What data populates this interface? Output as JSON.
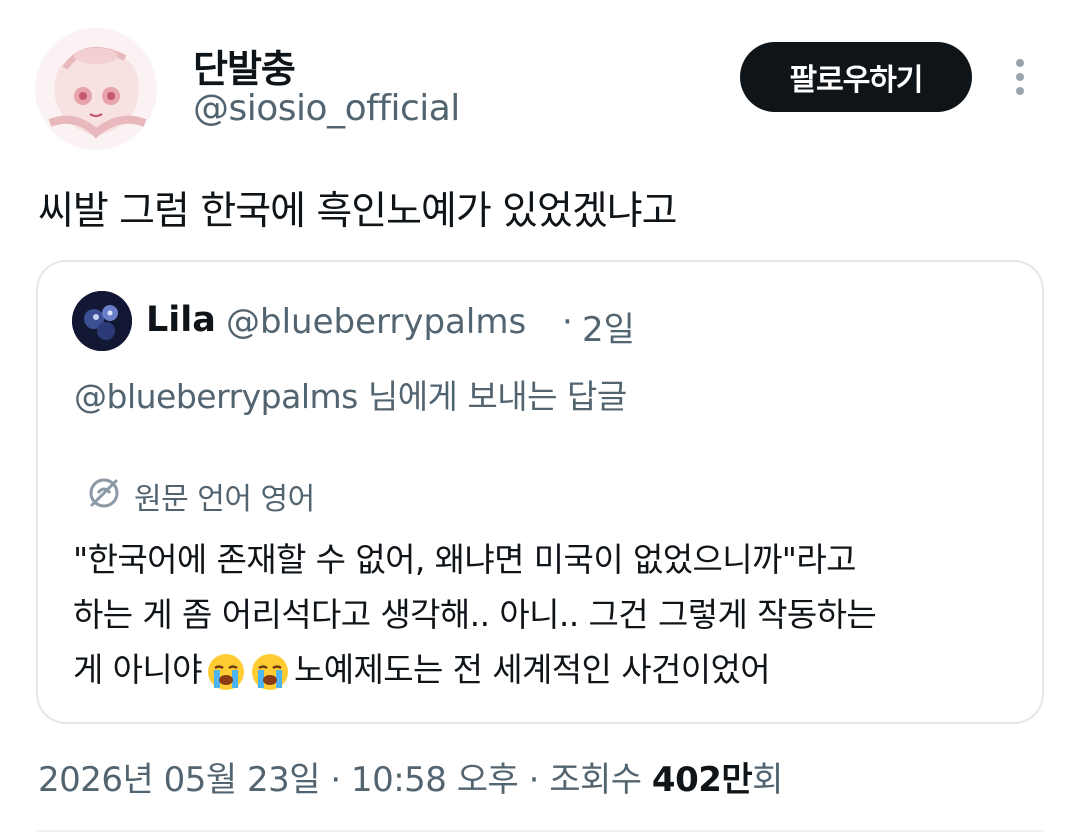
{
  "author": {
    "display_name": "단발충",
    "handle": "@siosio_official",
    "follow_label": "팔로우하기"
  },
  "tweet": {
    "text": "씨발 그럼 한국에 흑인노예가 있었겠냐고"
  },
  "quote": {
    "name": "Lila",
    "handle": "@blueberrypalms",
    "separator": "·",
    "time": "2일",
    "reply_to": "@blueberrypalms 님에게 보내는 답글",
    "translate_label": "원문 언어 영어",
    "body_line1": "\"한국어에 존재할 수 없어, 왜냐면 미국이 없었으니까\"라고",
    "body_line2": "하는 게 좀 어리석다고 생각해.. 아니.. 그건 그렇게 작동하는",
    "body_line3_a": "게 아니야",
    "body_line3_b": "노예제도는 전 세계적인 사건이었어",
    "emoji": "loudly-crying-face"
  },
  "meta": {
    "date": "2026년 05월 23일",
    "sep1": "·",
    "time": "10:58 오후",
    "sep2": "·",
    "views_label": "조회수",
    "views_num": "402만",
    "views_unit": "회"
  },
  "colors": {
    "primary_text": "#0f1419",
    "secondary_text": "#536471",
    "border": "#e1e8ed",
    "button_bg": "#0f1419"
  }
}
